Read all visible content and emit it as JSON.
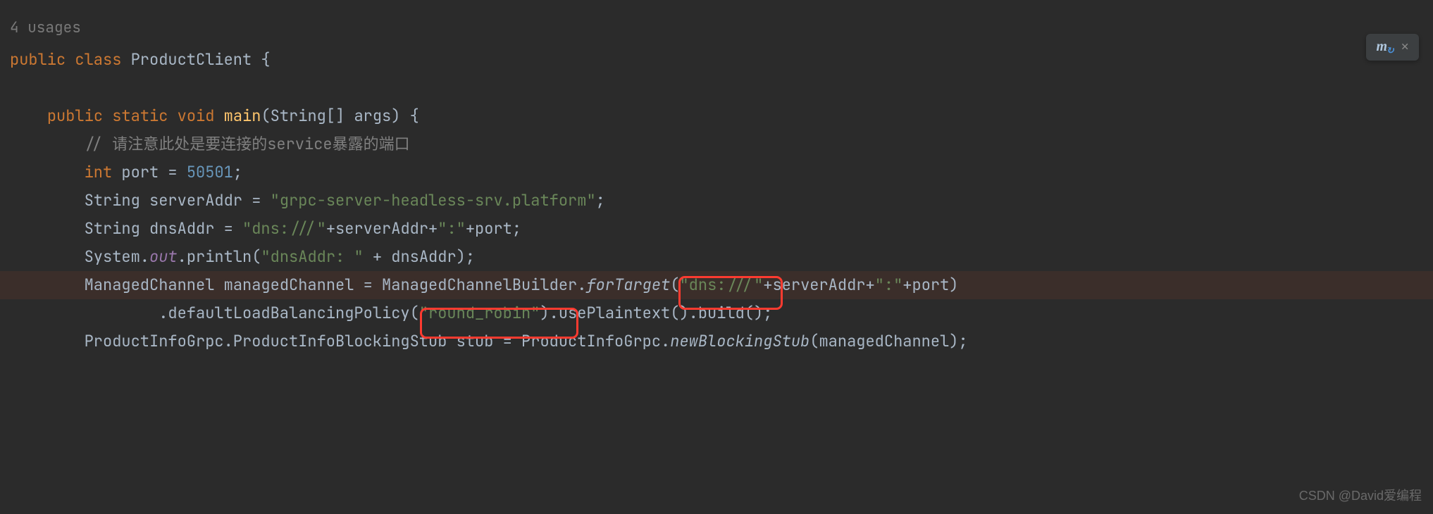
{
  "usages": "4 usages",
  "class_kw": "public class",
  "class_name": "ProductClient",
  "main_sig": {
    "mods": "public static void",
    "name": "main",
    "params": "(String[] args) {"
  },
  "comment": "// 请注意此处是要连接的service暴露的端口",
  "port_decl": {
    "kw": "int",
    "name": "port",
    "val": "50501"
  },
  "server_decl": {
    "type": "String",
    "name": "serverAddr",
    "val": "\"grpc-server-headless-srv.platform\""
  },
  "dns_decl": {
    "type": "String",
    "name": "dnsAddr",
    "str1": "\"dns:///\"",
    "plus1": "+serverAddr+",
    "str2": "\":\"",
    "plus2": "+port;"
  },
  "println": {
    "sys": "System.",
    "out": "out",
    "call": ".println(",
    "str": "\"dnsAddr: \"",
    "rest": " + dnsAddr);"
  },
  "mc": {
    "type": "ManagedChannel",
    "var": "managedChannel",
    "builder": "ManagedChannelBuilder.",
    "forTarget": "forTarget",
    "arg1": "\"dns:///\"",
    "argrest": "+serverAddr+",
    "colon": "\":\"",
    "portrest": "+port)"
  },
  "mc2": {
    "lb": ".defaultLoadBalancingPolicy(",
    "rr": "\"round_robin\"",
    "after": ").usePlaintext().build();"
  },
  "stub": {
    "t": "ProductInfoGrpc.ProductInfoBlockingStub",
    "v": "stub",
    "g": "ProductInfoGrpc.",
    "m": "newBlockingStub",
    "arg": "(managedChannel);"
  },
  "watermark": "CSDN @David爱编程"
}
